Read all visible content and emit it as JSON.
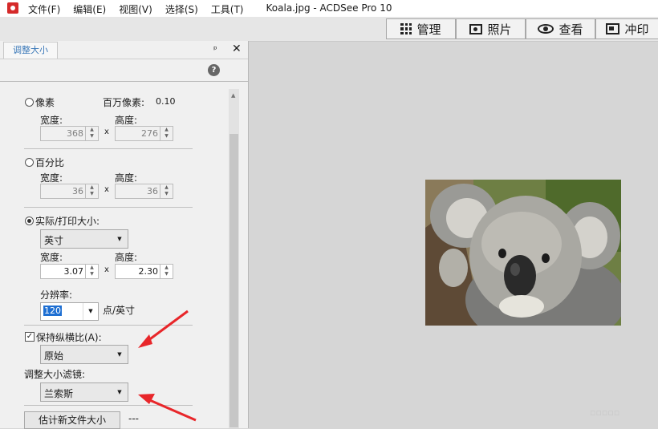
{
  "menu": [
    "文件(F)",
    "编辑(E)",
    "视图(V)",
    "选择(S)",
    "工具(T)"
  ],
  "window_title": "Koala.jpg - ACDSee Pro 10",
  "modes": [
    {
      "label": "管理",
      "icon": "grid-icon"
    },
    {
      "label": "照片",
      "icon": "photos-icon"
    },
    {
      "label": "查看",
      "icon": "eye-icon"
    },
    {
      "label": "冲印",
      "icon": "develop-icon"
    }
  ],
  "panel": {
    "tab_label": "调整大小",
    "pin_glyph": "ᵖ",
    "close_glyph": "✕",
    "help_glyph": "?"
  },
  "pixels": {
    "label": "像素",
    "megapixels_label": "百万像素:",
    "megapixels_value": "0.10",
    "width_label": "宽度:",
    "width": "368",
    "times": "x",
    "height_label": "高度:",
    "height": "276"
  },
  "percent": {
    "label": "百分比",
    "width_label": "宽度:",
    "width": "36",
    "times": "x",
    "height_label": "高度:",
    "height": "36"
  },
  "actual": {
    "label": "实际/打印大小:",
    "unit": "英寸",
    "width_label": "宽度:",
    "width": "3.07",
    "times": "x",
    "height_label": "高度:",
    "height": "2.30",
    "resolution_label": "分辨率:",
    "resolution": "120",
    "resolution_unit": "点/英寸"
  },
  "aspect": {
    "label": "保持纵横比(A):",
    "checked": true,
    "value": "原始"
  },
  "filter": {
    "label": "调整大小滤镜:",
    "value": "兰索斯"
  },
  "estimate": {
    "button_label": "估计新文件大小",
    "value": "---"
  },
  "image": {
    "subject": "koala photo"
  },
  "colors": {
    "tab_text": "#3a78b8",
    "selection": "#1e6fd2",
    "arrow": "#e8262a"
  }
}
